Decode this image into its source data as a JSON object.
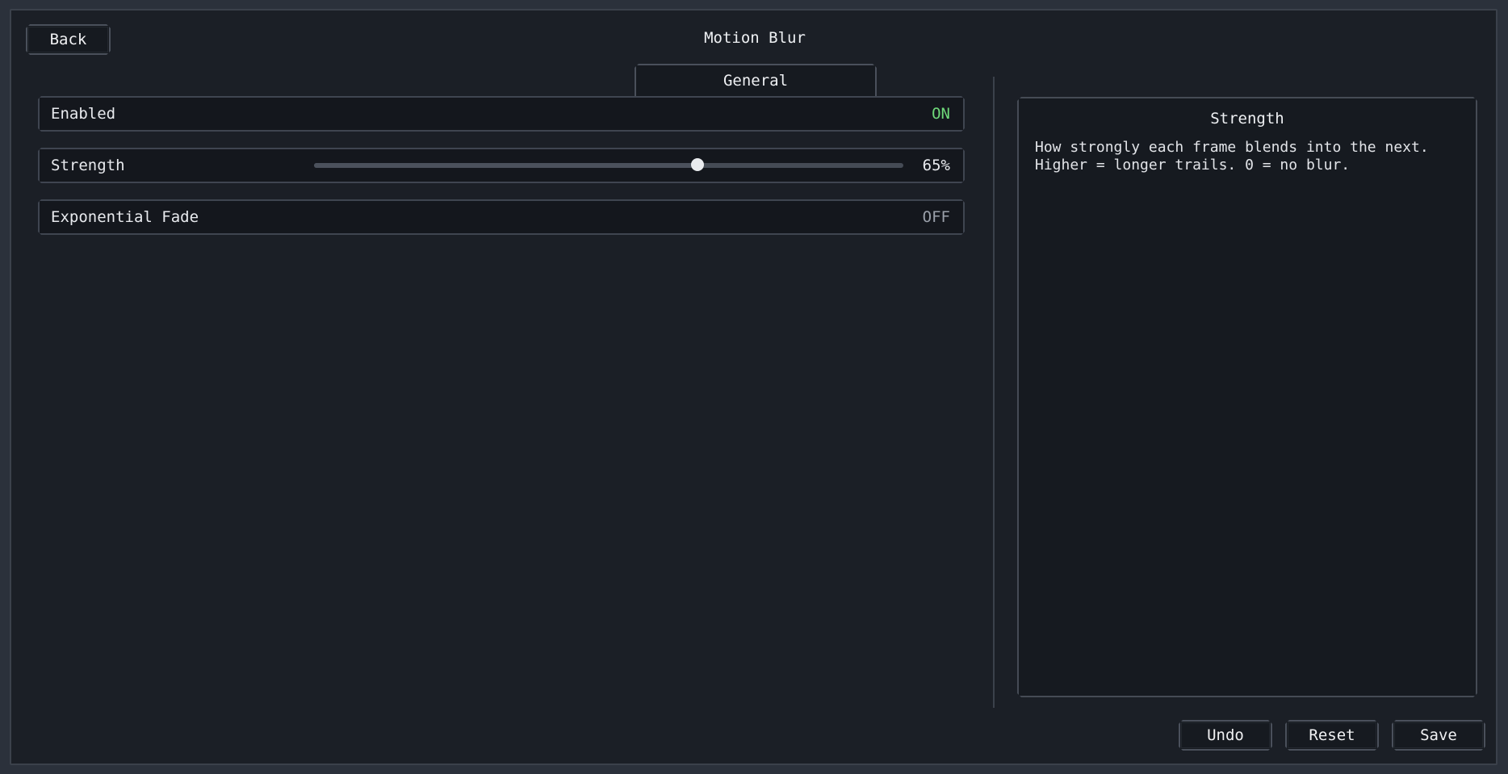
{
  "header": {
    "back_label": "Back",
    "title": "Motion Blur"
  },
  "tabs": [
    {
      "label": "General",
      "active": true
    }
  ],
  "settings": [
    {
      "label": "Enabled",
      "type": "toggle",
      "value": "ON",
      "on": true
    },
    {
      "label": "Strength",
      "type": "slider",
      "value": "65%",
      "fraction": 0.65
    },
    {
      "label": "Exponential Fade",
      "type": "toggle",
      "value": "OFF",
      "on": false
    }
  ],
  "info_panel": {
    "title": "Strength",
    "description_lines": [
      "How strongly each frame blends into the next.",
      "Higher = longer trails. 0 = no blur."
    ]
  },
  "footer": {
    "undo_label": "Undo",
    "reset_label": "Reset",
    "save_label": "Save"
  },
  "colors": {
    "on": "#6fd97a",
    "off": "#9aa0aa",
    "background": "#1b1f26"
  }
}
